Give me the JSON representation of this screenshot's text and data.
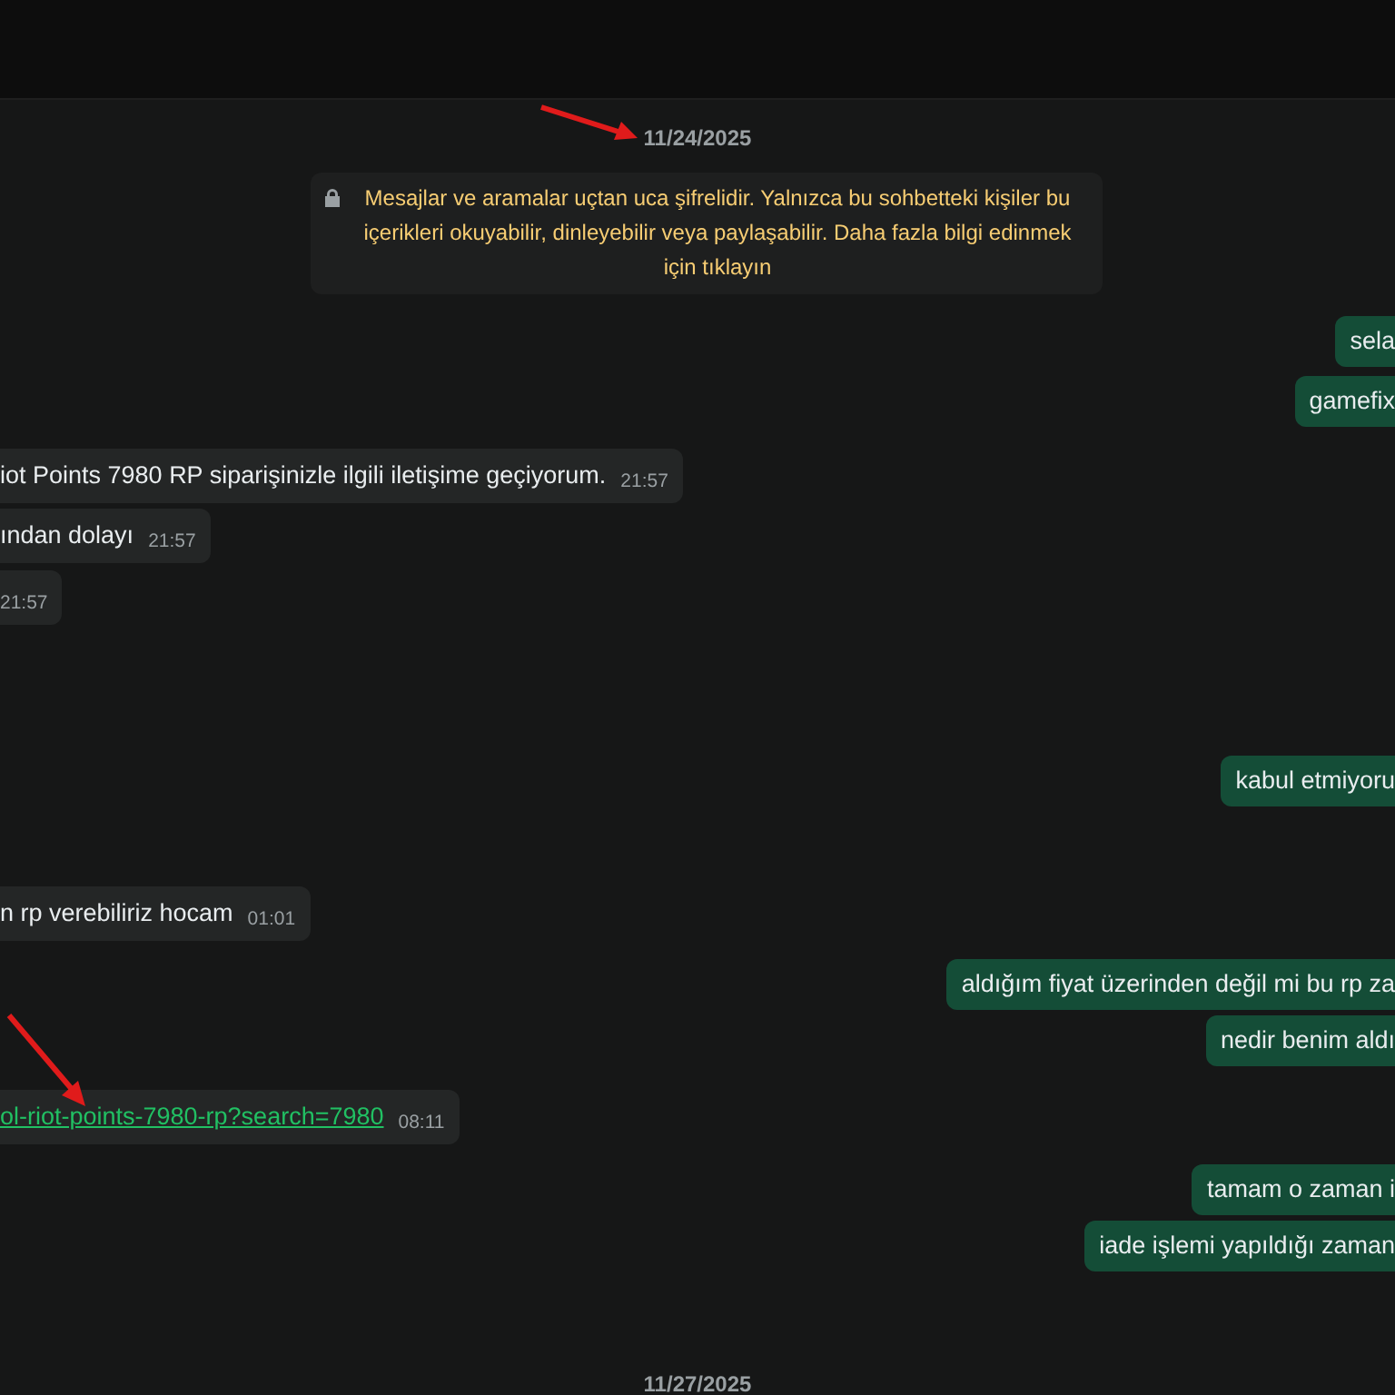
{
  "chat": [
    {
      "kind": "date",
      "text": "11/24/2025"
    },
    {
      "kind": "notice",
      "text": "Mesajlar ve aramalar uçtan uca şifrelidir. Yalnızca bu sohbetteki kişiler bu içerikleri okuyabilir, dinleyebilir veya paylaşabilir. Daha fazla bilgi edinmek için tıklayın"
    },
    {
      "kind": "outgoing",
      "text": "sela"
    },
    {
      "kind": "outgoing",
      "text": "gamefix"
    },
    {
      "kind": "incoming",
      "text": "iot Points 7980 RP siparişinizle ilgili iletişime geçiyorum.",
      "time": "21:57"
    },
    {
      "kind": "incoming",
      "text": "ından dolayı",
      "time": "21:57"
    },
    {
      "kind": "incoming",
      "time": "21:57"
    },
    {
      "kind": "outgoing",
      "text": "kabul etmiyoru"
    },
    {
      "kind": "incoming",
      "text": "n rp verebiliriz hocam",
      "time": "01:01"
    },
    {
      "kind": "outgoing",
      "text": "aldığım fiyat üzerinden değil mi bu rp za"
    },
    {
      "kind": "outgoing",
      "text": "nedir benim aldı"
    },
    {
      "kind": "incoming_link",
      "text": "ol-riot-points-7980-rp?search=7980",
      "time": "08:11"
    },
    {
      "kind": "outgoing",
      "text": "tamam o zaman i"
    },
    {
      "kind": "outgoing",
      "text": "iade işlemi yapıldığı zaman"
    },
    {
      "kind": "date",
      "text": "11/27/2025"
    }
  ]
}
